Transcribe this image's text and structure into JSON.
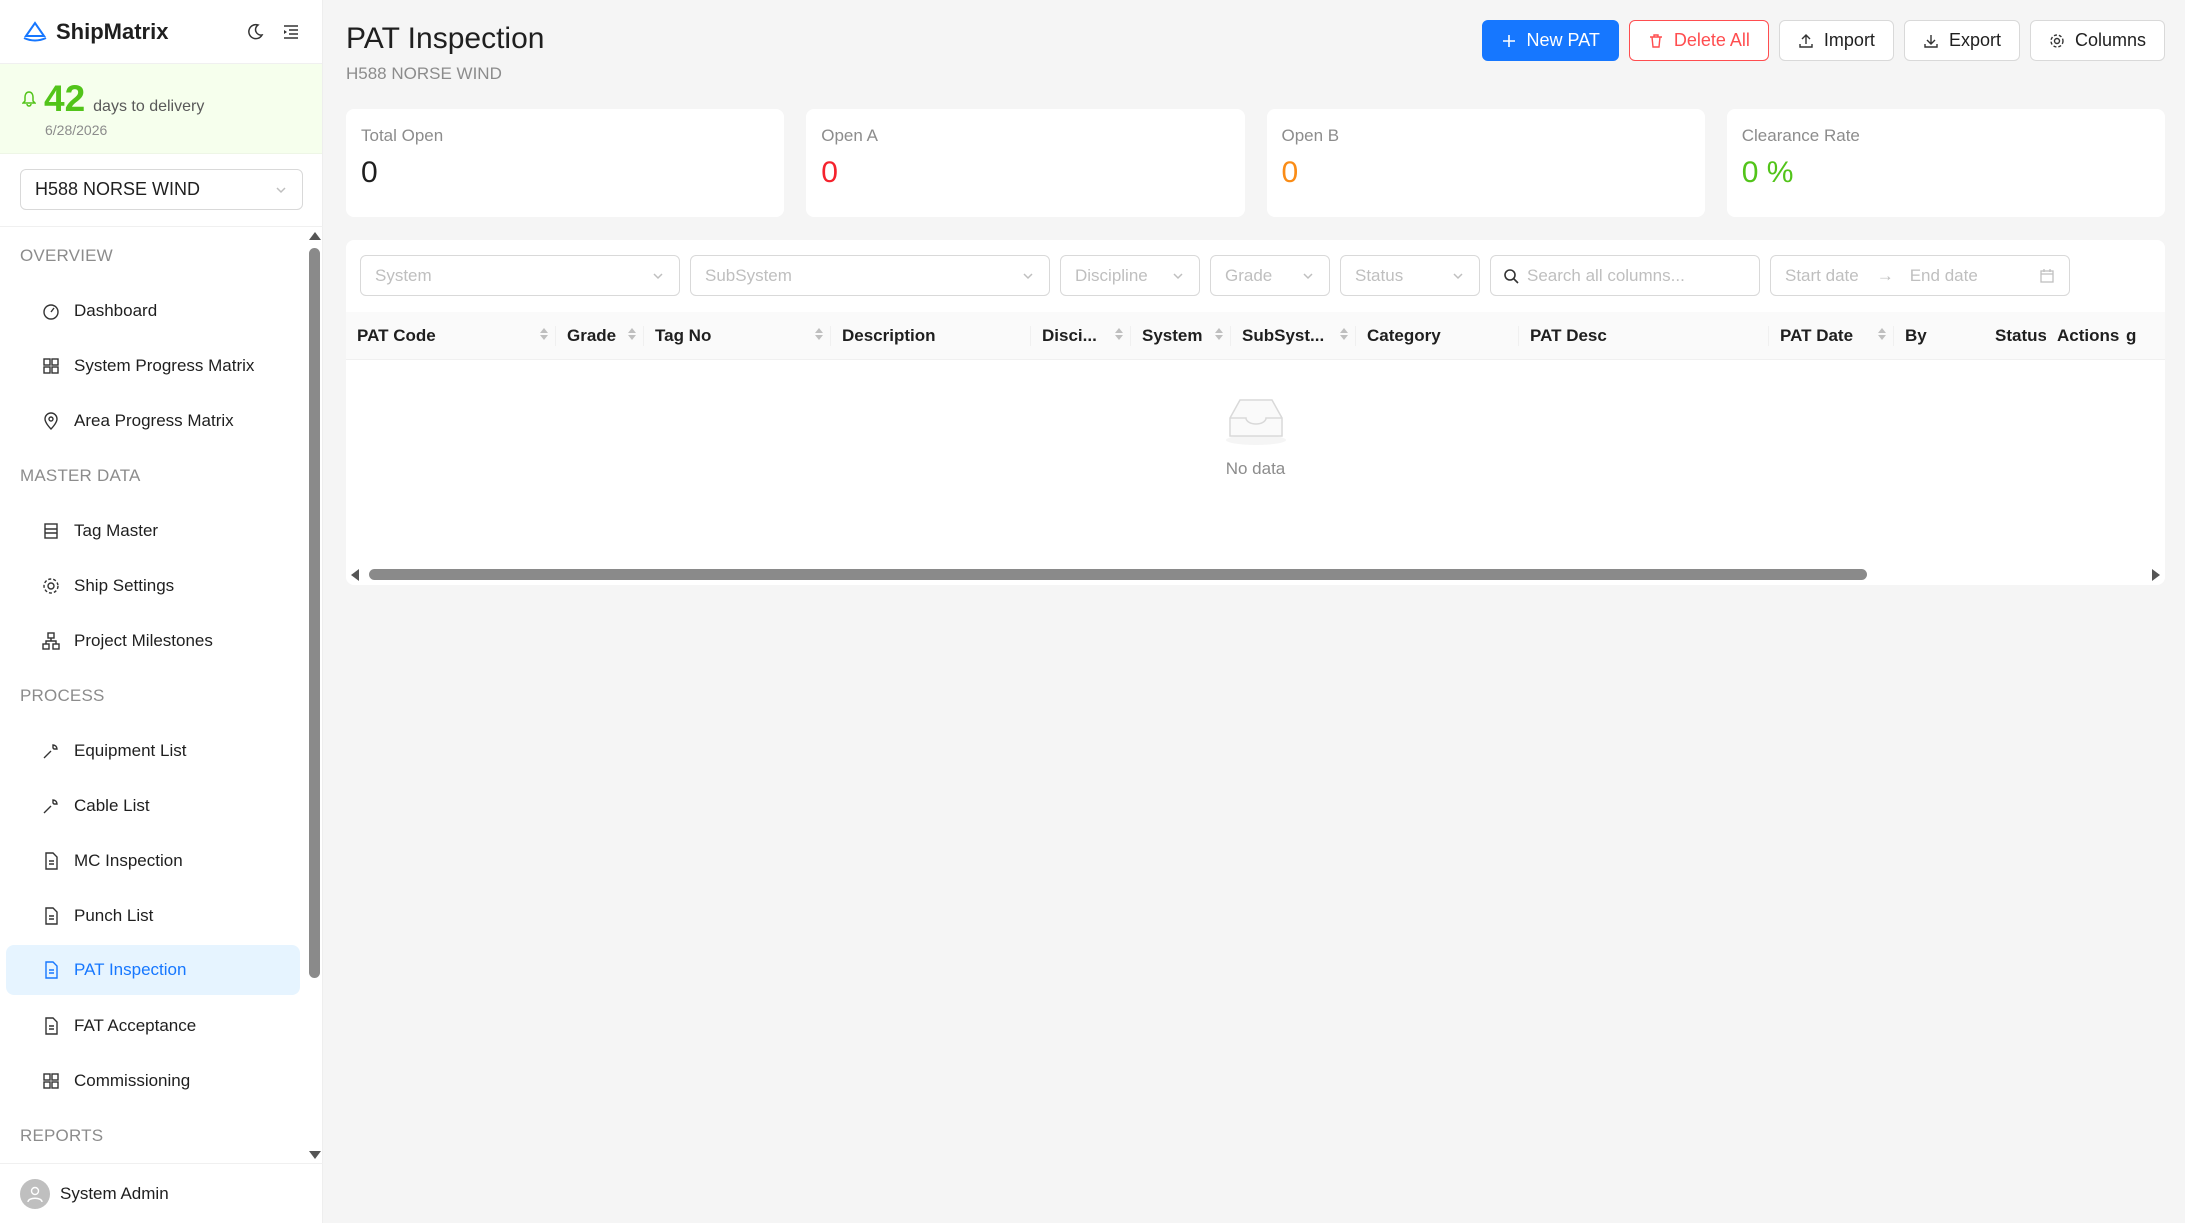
{
  "brand": {
    "name": "ShipMatrix"
  },
  "delivery": {
    "days": "42",
    "label": "days to delivery",
    "date": "6/28/2026"
  },
  "ship_select": {
    "value": "H588 NORSE WIND"
  },
  "nav": {
    "groups": {
      "overview": "OVERVIEW",
      "master_data": "MASTER DATA",
      "process": "PROCESS",
      "reports": "REPORTS"
    },
    "items": {
      "dashboard": "Dashboard",
      "system_progress": "System Progress Matrix",
      "area_progress": "Area Progress Matrix",
      "tag_master": "Tag Master",
      "ship_settings": "Ship Settings",
      "project_milestones": "Project Milestones",
      "equipment_list": "Equipment List",
      "cable_list": "Cable List",
      "mc_inspection": "MC Inspection",
      "punch_list": "Punch List",
      "pat_inspection": "PAT Inspection",
      "fat_acceptance": "FAT Acceptance",
      "commissioning": "Commissioning"
    }
  },
  "user": {
    "name": "System Admin"
  },
  "page": {
    "title": "PAT Inspection",
    "subtitle": "H588 NORSE WIND"
  },
  "toolbar": {
    "new": "New PAT",
    "delete_all": "Delete All",
    "import": "Import",
    "export": "Export",
    "columns": "Columns"
  },
  "stats": [
    {
      "label": "Total Open",
      "value": "0",
      "color": "#1f1f1f"
    },
    {
      "label": "Open A",
      "value": "0",
      "color": "#f5222d"
    },
    {
      "label": "Open B",
      "value": "0",
      "color": "#fa8c16"
    },
    {
      "label": "Clearance Rate",
      "value": "0 %",
      "color": "#52c41a"
    }
  ],
  "filters": {
    "system": "System",
    "subsystem": "SubSystem",
    "discipline": "Discipline",
    "grade": "Grade",
    "status": "Status",
    "search": "Search all columns...",
    "start_date": "Start date",
    "end_date": "End date"
  },
  "columns": [
    "PAT Code",
    "Grade",
    "Tag No",
    "Description",
    "Disci...",
    "System",
    "SubSyst...",
    "Category",
    "PAT Desc",
    "PAT Date",
    "By",
    "Status",
    "Actions",
    "g"
  ],
  "empty": {
    "text": "No data"
  },
  "colors": {
    "primary": "#1677ff",
    "danger": "#ff4d4f",
    "success": "#52c41a",
    "warning": "#fa8c16"
  }
}
